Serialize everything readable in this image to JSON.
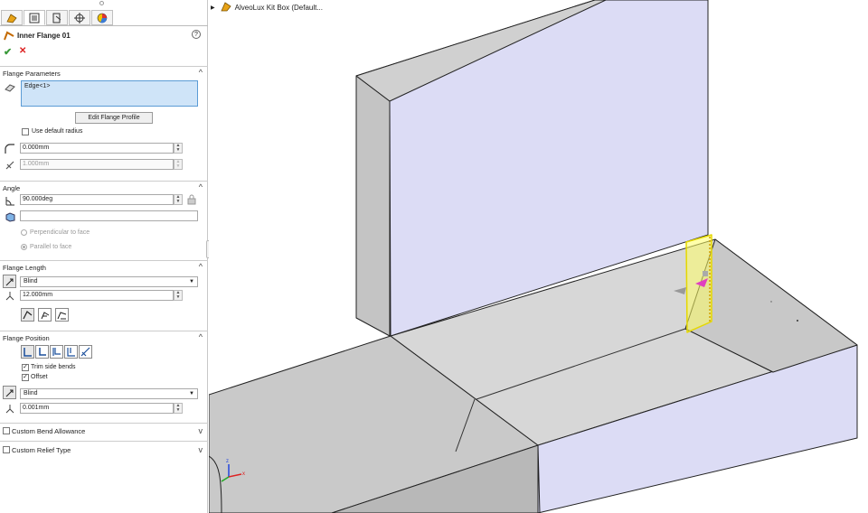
{
  "tree": {
    "part_name": "AlveoLux Kit Box  (Default..."
  },
  "property_manager": {
    "tabs": [
      "feature-manager",
      "property-manager",
      "configuration-manager",
      "dimxpert-manager",
      "display-manager"
    ],
    "feature_title": "Inner Flange 01",
    "help_label": "?",
    "flange_parameters": {
      "header": "Flange Parameters",
      "edge_item": "Edge<1>",
      "edit_profile_label": "Edit Flange Profile",
      "use_default_radius_label": "Use default radius",
      "use_default_radius_checked": false,
      "bend_radius": "0.000mm",
      "gap_distance": "1.000mm"
    },
    "angle": {
      "header": "Angle",
      "angle_value": "90.000deg",
      "reference_face": "",
      "perpendicular_label": "Perpendicular to face",
      "parallel_label": "Parallel to face"
    },
    "flange_length": {
      "header": "Flange Length",
      "end_condition": "Blind",
      "length": "12.000mm"
    },
    "flange_position": {
      "header": "Flange Position",
      "trim_side_bends_label": "Trim side bends",
      "trim_side_bends_checked": true,
      "offset_label": "Offset",
      "offset_checked": true,
      "offset_end_condition": "Blind",
      "offset_distance": "0.001mm"
    },
    "custom_bend_allowance": {
      "header": "Custom Bend Allowance",
      "checked": false
    },
    "custom_relief_type": {
      "header": "Custom Relief Type",
      "checked": false
    }
  },
  "colors": {
    "model_face": "#dcdcf5",
    "model_gray": "#c8c8c8",
    "highlight": "#ffff00",
    "selection_blue": "#cfe4f8"
  }
}
